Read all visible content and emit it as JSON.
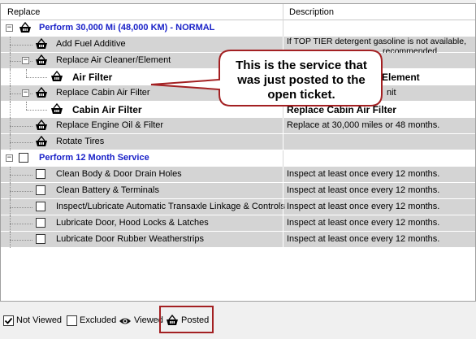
{
  "columns": {
    "replace": "Replace",
    "description": "Description"
  },
  "rows": [
    {
      "label": "Perform 30,000 Mi (48,000 KM) - NORMAL",
      "description": "",
      "style": "group",
      "icon": "basket-icon",
      "expander": "−"
    },
    {
      "label": "Add Fuel Additive",
      "description": "If TOP TIER detergent gasoline is not available,",
      "description_line2": "recommended.",
      "style": "item",
      "icon": "basket-icon"
    },
    {
      "label": "Replace Air Cleaner/Element",
      "description": "",
      "style": "item",
      "icon": "basket-icon",
      "expander": "−"
    },
    {
      "label": "Air Filter",
      "description": "Element",
      "style": "posted",
      "icon": "basket-icon"
    },
    {
      "label": "Replace Cabin Air Filter",
      "description": "nit",
      "style": "item",
      "icon": "basket-icon",
      "expander": "−"
    },
    {
      "label": "Cabin Air Filter",
      "description": "Replace Cabin Air Filter",
      "style": "posted",
      "icon": "basket-icon"
    },
    {
      "label": "Replace Engine Oil & Filter",
      "description": "Replace at 30,000 miles or 48 months.",
      "style": "item",
      "icon": "basket-icon"
    },
    {
      "label": "Rotate Tires",
      "description": "",
      "style": "item",
      "icon": "basket-icon"
    },
    {
      "label": "Perform 12 Month Service",
      "description": "",
      "style": "group",
      "icon": "checkbox-icon",
      "expander": "−"
    },
    {
      "label": "Clean Body & Door Drain Holes",
      "description": "Inspect at least once every  12 months.",
      "style": "item",
      "icon": "checkbox-icon"
    },
    {
      "label": "Clean Battery & Terminals",
      "description": "Inspect at least once every  12 months.",
      "style": "item",
      "icon": "checkbox-icon"
    },
    {
      "label": "Inspect/Lubricate Automatic Transaxle Linkage & Controls",
      "description": "Inspect at least once every  12 months.",
      "style": "item",
      "icon": "checkbox-icon"
    },
    {
      "label": "Lubricate Door, Hood Locks & Latches",
      "description": "Inspect at least once every  12 months.",
      "style": "item",
      "icon": "checkbox-icon"
    },
    {
      "label": "Lubricate Door Rubber Weatherstrips",
      "description": "Inspect at least once every  12 months.",
      "style": "item",
      "icon": "checkbox-icon"
    }
  ],
  "callout": {
    "text": "This is the service that was just posted to the open ticket."
  },
  "legend": [
    {
      "label": "Not Viewed",
      "icon": "checked-checkbox-icon"
    },
    {
      "label": "Excluded",
      "icon": "empty-checkbox-icon"
    },
    {
      "label": "Viewed",
      "icon": "eye-icon"
    },
    {
      "label": "Posted",
      "icon": "basket-icon"
    }
  ],
  "colors": {
    "group_text": "#1a22c8",
    "row_gray": "#d4d4d4",
    "callout_border": "#a32022",
    "callout_fill": "#ffffff"
  }
}
